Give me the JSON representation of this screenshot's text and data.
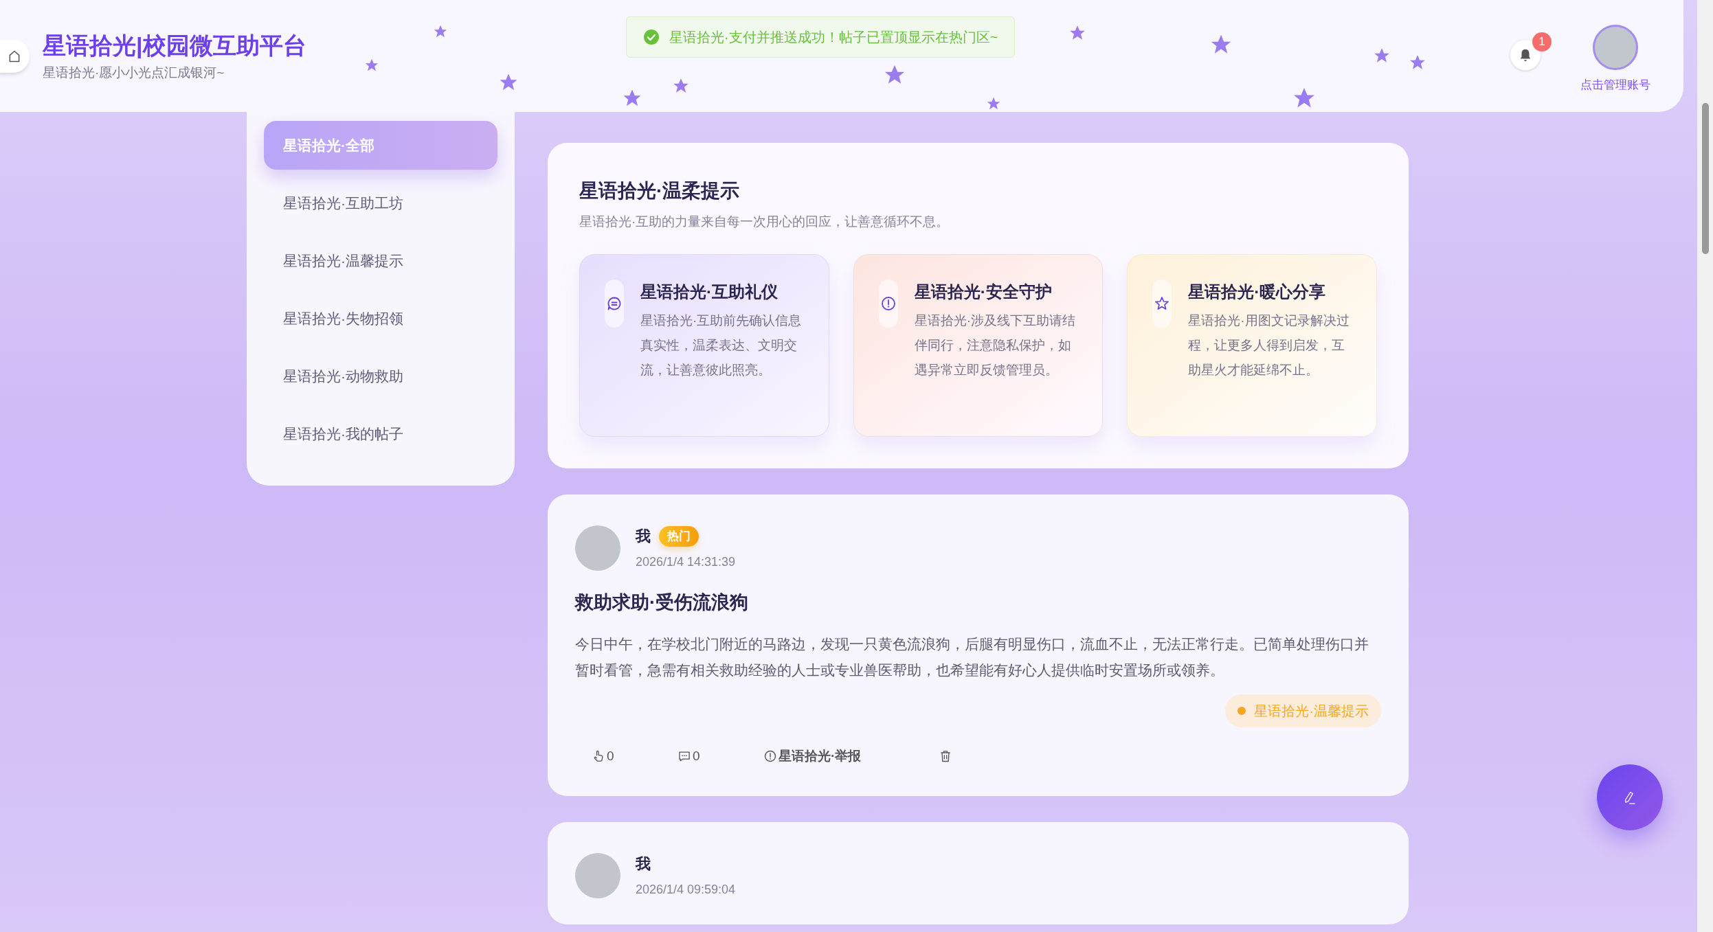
{
  "header": {
    "title": "星语拾光|校园微互助平台",
    "subtitle": "星语拾光·愿小小光点汇成银河~"
  },
  "toast": {
    "kind": "success",
    "text": "星语拾光·支付并推送成功！帖子已置顶显示在热门区~"
  },
  "notifications": {
    "count": "1"
  },
  "account": {
    "label": "点击管理账号"
  },
  "sidebar": {
    "items": [
      {
        "label": "星语拾光·全部",
        "selected": true
      },
      {
        "label": "星语拾光·互助工坊",
        "selected": false
      },
      {
        "label": "星语拾光·温馨提示",
        "selected": false
      },
      {
        "label": "星语拾光·失物招领",
        "selected": false
      },
      {
        "label": "星语拾光·动物救助",
        "selected": false
      },
      {
        "label": "星语拾光·我的帖子",
        "selected": false
      }
    ]
  },
  "tips": {
    "title": "星语拾光·温柔提示",
    "subtitle": "星语拾光·互助的力量来自每一次用心的回应，让善意循环不息。",
    "cards": [
      {
        "kind": "etiquette",
        "title": "星语拾光·互助礼仪",
        "text": "星语拾光·互助前先确认信息真实性，温柔表达、文明交流，让善意彼此照亮。"
      },
      {
        "kind": "safety",
        "title": "星语拾光·安全守护",
        "text": "星语拾光·涉及线下互助请结伴同行，注意隐私保护，如遇异常立即反馈管理员。"
      },
      {
        "kind": "sharing",
        "title": "星语拾光·暖心分享",
        "text": "星语拾光·用图文记录解决过程，让更多人得到启发，互助星火才能延绵不止。"
      }
    ]
  },
  "posts": [
    {
      "author": "我",
      "badge": "热门",
      "time": "2026/1/4 14:31:39",
      "title": "救助求助·受伤流浪狗",
      "body": "今日中午，在学校北门附近的马路边，发现一只黄色流浪狗，后腿有明显伤口，流血不止，无法正常行走。已简单处理伤口并暂时看管，急需有相关救助经验的人士或专业兽医帮助，也希望能有好心人提供临时安置场所或领养。",
      "tag": "星语拾光·温馨提示",
      "likes": "0",
      "comments": "0",
      "report": "星语拾光·举报"
    },
    {
      "author": "我",
      "time": "2026/1/4 09:59:04"
    }
  ]
}
